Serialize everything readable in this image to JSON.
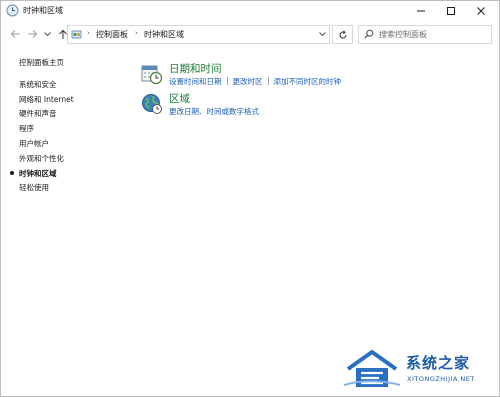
{
  "window": {
    "title": "时钟和区域"
  },
  "address": {
    "crumbs": [
      "控制面板",
      "时钟和区域"
    ],
    "search_placeholder": "搜索控制面板"
  },
  "sidebar": {
    "items": [
      {
        "label": "控制面板主页"
      },
      {
        "label": "系统和安全"
      },
      {
        "label": "网络和 Internet"
      },
      {
        "label": "硬件和声音"
      },
      {
        "label": "程序"
      },
      {
        "label": "用户帐户"
      },
      {
        "label": "外观和个性化"
      },
      {
        "label": "时钟和区域",
        "active": true
      },
      {
        "label": "轻松使用"
      }
    ]
  },
  "main": {
    "categories": [
      {
        "title": "日期和时间",
        "icon": "calendar-clock-icon",
        "links": [
          "设置时间和日期",
          "更改时区",
          "添加不同时区的时钟"
        ]
      },
      {
        "title": "区域",
        "icon": "globe-clock-icon",
        "links": [
          "更改日期、时间或数字格式"
        ]
      }
    ]
  },
  "watermark": {
    "brand_cn": "系统之家",
    "brand_en": "XITONGZHIJIA.NET"
  },
  "colors": {
    "link": "#1a5fb4",
    "category_title": "#1e7b38",
    "watermark": "#1e5aa8"
  }
}
